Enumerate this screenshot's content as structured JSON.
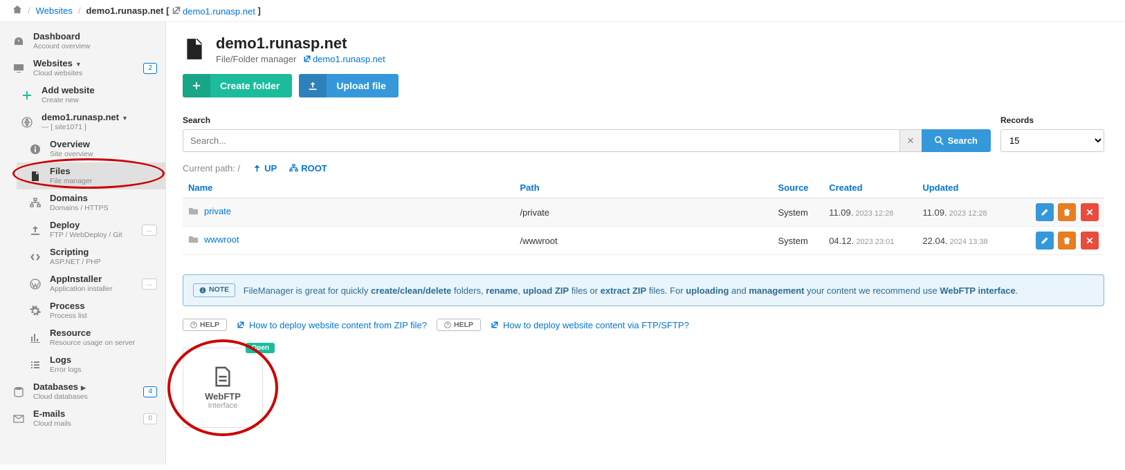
{
  "breadcrumb": {
    "sep": "/",
    "websites": "Websites",
    "hostPrefix": "demo1.runasp.net [",
    "hostLink": "demo1.runasp.net",
    "hostSuffix": "]"
  },
  "sidebar": {
    "dashboard": {
      "title": "Dashboard",
      "sub": "Account overview"
    },
    "websites": {
      "title": "Websites",
      "sub": "Cloud websites",
      "badge": "2"
    },
    "add": {
      "title": "Add website",
      "sub": "Create new"
    },
    "site": {
      "title": "demo1.runasp.net",
      "sub": "--- [ site1071 ]"
    },
    "overview": {
      "title": "Overview",
      "sub": "Site overview"
    },
    "files": {
      "title": "Files",
      "sub": "File manager"
    },
    "domains": {
      "title": "Domains",
      "sub": "Domains / HTTPS"
    },
    "deploy": {
      "title": "Deploy",
      "sub": "FTP / WebDeploy / Git",
      "badge": "..."
    },
    "scripting": {
      "title": "Scripting",
      "sub": "ASP.NET / PHP"
    },
    "appinst": {
      "title": "AppInstaller",
      "sub": "Application installer",
      "badge": "..."
    },
    "process": {
      "title": "Process",
      "sub": "Process list"
    },
    "resource": {
      "title": "Resource",
      "sub": "Resource usage on server"
    },
    "logs": {
      "title": "Logs",
      "sub": "Error logs"
    },
    "databases": {
      "title": "Databases",
      "sub": "Cloud databases",
      "badge": "4"
    },
    "emails": {
      "title": "E-mails",
      "sub": "Cloud mails",
      "badge": "0"
    }
  },
  "header": {
    "title": "demo1.runasp.net",
    "sub": "File/Folder manager",
    "link": "demo1.runasp.net"
  },
  "buttons": {
    "create": "Create folder",
    "upload": "Upload file"
  },
  "search": {
    "label": "Search",
    "placeholder": "Search...",
    "button": "Search",
    "recordsLabel": "Records",
    "recordsValue": "15"
  },
  "path": {
    "label": "Current path:",
    "value": "/",
    "up": "UP",
    "root": "ROOT"
  },
  "table": {
    "cols": {
      "name": "Name",
      "path": "Path",
      "source": "Source",
      "created": "Created",
      "updated": "Updated"
    },
    "rows": [
      {
        "name": "private",
        "path": "/private",
        "source": "System",
        "created1": "11.09.",
        "created2": "2023 12:28",
        "updated1": "11.09.",
        "updated2": "2023 12:28"
      },
      {
        "name": "wwwroot",
        "path": "/wwwroot",
        "source": "System",
        "created1": "04.12.",
        "created2": "2023 23:01",
        "updated1": "22.04.",
        "updated2": "2024 13:38"
      }
    ]
  },
  "note": {
    "tag": "NOTE",
    "t1": "FileManager is great for quickly ",
    "b1": "create/clean/delete",
    "t2": " folders, ",
    "b2": "rename",
    "t3": ", ",
    "b3": "upload ZIP",
    "t4": " files or ",
    "b4": "extract ZIP",
    "t5": " files. For ",
    "b5": "uploading",
    "t6": " and ",
    "b6": "management",
    "t7": " your content we recommend use ",
    "b7": "WebFTP interface",
    "t8": "."
  },
  "help": {
    "tag": "HELP",
    "link1": "How to deploy website content from ZIP file?",
    "link2": "How to deploy website content via FTP/SFTP?"
  },
  "card": {
    "badge": "Open",
    "title": "WebFTP",
    "sub": "Interface"
  }
}
